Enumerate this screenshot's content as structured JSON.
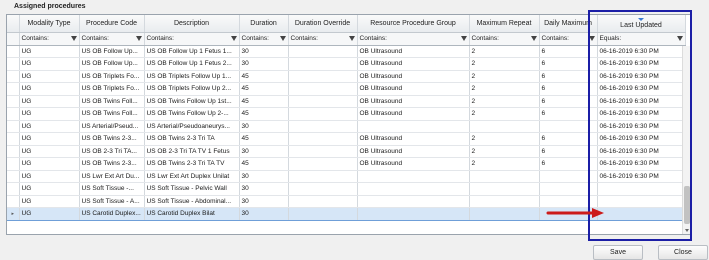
{
  "section_title": "Assigned procedures",
  "columns": [
    {
      "label": "Modality Type",
      "filter": "Contains:"
    },
    {
      "label": "Procedure Code",
      "filter": "Contains:"
    },
    {
      "label": "Description",
      "filter": "Contains:"
    },
    {
      "label": "Duration",
      "filter": "Contains:"
    },
    {
      "label": "Duration Override",
      "filter": "Contains:"
    },
    {
      "label": "Resource Procedure Group",
      "filter": "Contains:"
    },
    {
      "label": "Maximum Repeat",
      "filter": "Contains:"
    },
    {
      "label": "Daily Maximum",
      "filter": "Contains:"
    },
    {
      "label": "Last Updated",
      "filter": "Equals:"
    }
  ],
  "rows": [
    [
      "UG",
      "US OB Follow Up...",
      "US OB Follow Up 1 Fetus 1...",
      "30",
      "",
      "OB Ultrasound",
      "2",
      "6",
      "06-16-2019 6:30 PM"
    ],
    [
      "UG",
      "US OB Follow Up...",
      "US OB Follow Up 1 Fetus 2...",
      "30",
      "",
      "OB Ultrasound",
      "2",
      "6",
      "06-16-2019 6:30 PM"
    ],
    [
      "UG",
      "US OB Triplets Fo...",
      "US OB Triplets Follow Up 1...",
      "45",
      "",
      "OB Ultrasound",
      "2",
      "6",
      "06-16-2019 6:30 PM"
    ],
    [
      "UG",
      "US OB Triplets Fo...",
      "US OB Triplets Follow Up 2...",
      "45",
      "",
      "OB Ultrasound",
      "2",
      "6",
      "06-16-2019 6:30 PM"
    ],
    [
      "UG",
      "US OB Twins Foll...",
      "US OB Twins Follow Up 1st...",
      "45",
      "",
      "OB Ultrasound",
      "2",
      "6",
      "06-16-2019 6:30 PM"
    ],
    [
      "UG",
      "US OB Twins Foll...",
      "US OB Twins Follow Up 2-...",
      "45",
      "",
      "OB Ultrasound",
      "2",
      "6",
      "06-16-2019 6:30 PM"
    ],
    [
      "UG",
      "US Arterial/Pseud...",
      "US Arterial/Pseudoaneurys...",
      "30",
      "",
      "",
      "",
      "",
      "06-16-2019 6:30 PM"
    ],
    [
      "UG",
      "US OB Twins 2-3...",
      "US OB Twins 2-3 Tri TA",
      "45",
      "",
      "OB Ultrasound",
      "2",
      "6",
      "06-16-2019 6:30 PM"
    ],
    [
      "UG",
      "US OB 2-3 Tri TA...",
      "US OB 2-3 Tri TA TV 1 Fetus",
      "30",
      "",
      "OB Ultrasound",
      "2",
      "6",
      "06-16-2019 6:30 PM"
    ],
    [
      "UG",
      "US OB Twins 2-3...",
      "US OB Twins 2-3 Tri TA TV",
      "45",
      "",
      "OB Ultrasound",
      "2",
      "6",
      "06-16-2019 6:30 PM"
    ],
    [
      "UG",
      "US Lwr Ext Art Du...",
      "US Lwr Ext Art Duplex Unilat",
      "30",
      "",
      "",
      "",
      "",
      "06-16-2019 6:30 PM"
    ],
    [
      "UG",
      "US Soft Tissue -...",
      "US Soft Tissue - Pelvic Wall",
      "30",
      "",
      "",
      "",
      "",
      ""
    ],
    [
      "UG",
      "US Soft Tissue - A...",
      "US Soft Tissue - Abdominal...",
      "30",
      "",
      "",
      "",
      "",
      ""
    ],
    [
      "UG",
      "US Carotid Duplex...",
      "US Carotid Duplex Bilat",
      "30",
      "",
      "",
      "",
      "",
      ""
    ]
  ],
  "selected_row_index": 13,
  "row_indicator": "▸",
  "buttons": {
    "save": "Save",
    "close": "Close"
  },
  "colors": {
    "highlight_box": "#1b1ea6",
    "annotation_arrow": "#cc1b1b",
    "selected_row": "#d6e6f7"
  }
}
